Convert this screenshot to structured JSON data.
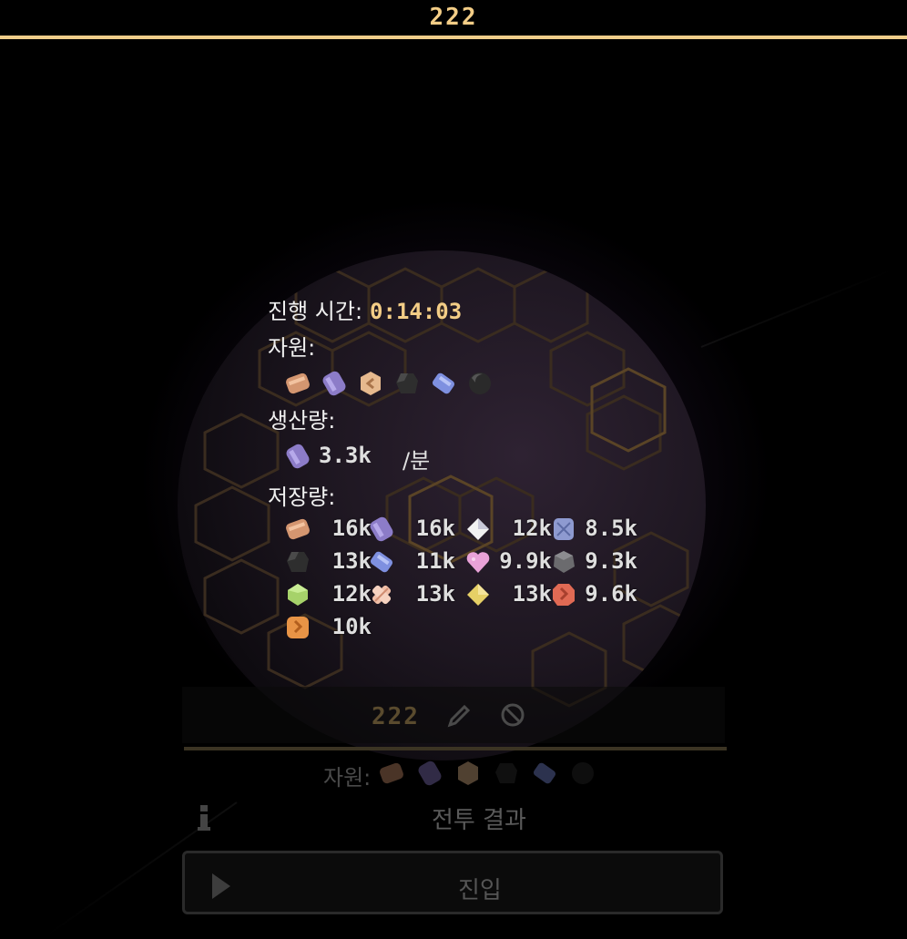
{
  "header": {
    "title": "222"
  },
  "tooltip": {
    "time_label": "진행 시간:",
    "time_value": "0:14:03",
    "resources_label": "자원:",
    "resources_icons": [
      "copper-resource-icon",
      "lavender-resource-icon",
      "peach-resource-icon",
      "coal-resource-icon",
      "blue-crystal-resource-icon",
      "dark-ore-resource-icon"
    ],
    "production_label": "생산량:",
    "production": {
      "icon": "lavender-resource-icon",
      "value": "3.3k",
      "unit": "/분"
    },
    "storage_label": "저장량:",
    "storage": [
      {
        "icon": "copper-bar-icon",
        "value": "16k"
      },
      {
        "icon": "lavender-bar-icon",
        "value": "16k"
      },
      {
        "icon": "white-crystal-icon",
        "value": "12k"
      },
      {
        "icon": "blue-block-icon",
        "value": "8.5k"
      },
      {
        "icon": "coal-icon",
        "value": "13k"
      },
      {
        "icon": "blue-crystal-icon",
        "value": "11k"
      },
      {
        "icon": "pink-heart-icon",
        "value": "9.9k"
      },
      {
        "icon": "gray-stone-icon",
        "value": "9.3k"
      },
      {
        "icon": "lime-gem-icon",
        "value": "12k"
      },
      {
        "icon": "striped-bar-icon",
        "value": "13k"
      },
      {
        "icon": "yellow-gem-icon",
        "value": "13k"
      },
      {
        "icon": "red-ore-icon",
        "value": "9.6k"
      },
      {
        "icon": "orange-ore-icon",
        "value": "10k"
      }
    ]
  },
  "panel": {
    "title": "222",
    "resources_label": "자원:",
    "battle_result": "전투 결과",
    "enter_label": "진입"
  },
  "colors": {
    "accent": "#f3cd86",
    "background": "#000000"
  }
}
